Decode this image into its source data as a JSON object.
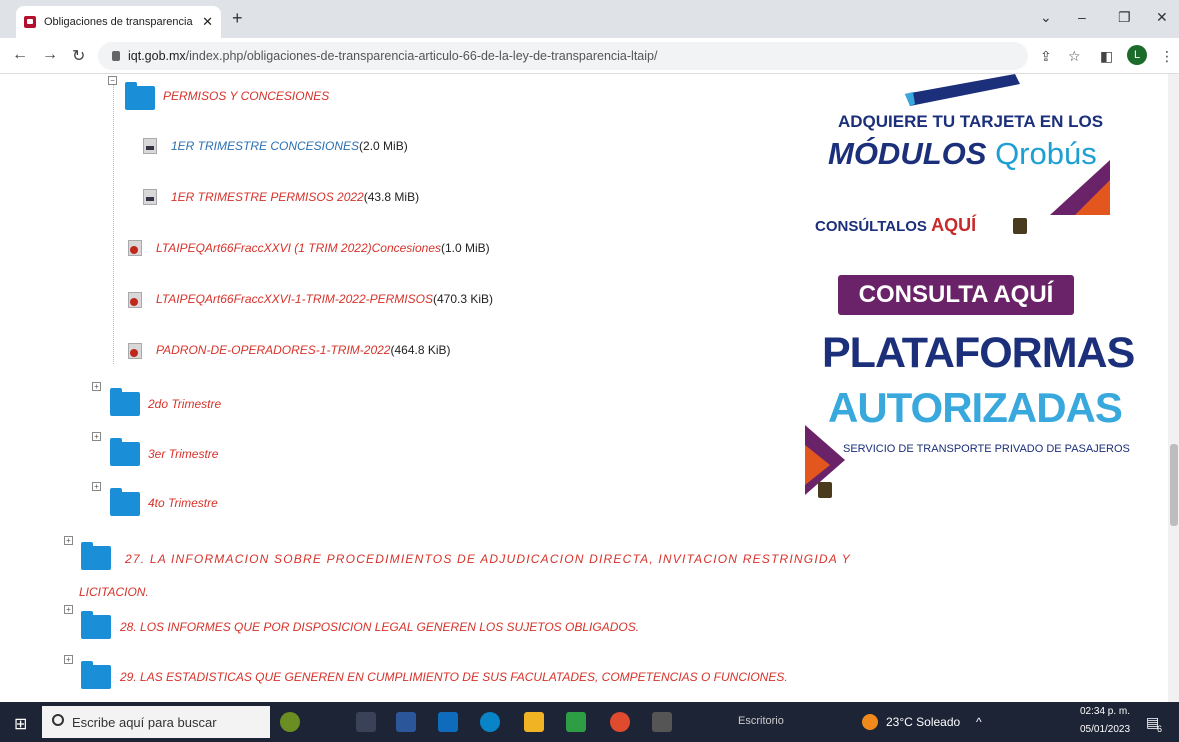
{
  "browser": {
    "tab_title": "Obligaciones de transparencia a",
    "tab_close": "✕",
    "new_tab": "+",
    "url_domain": "iqt.gob.mx",
    "url_path": "/index.php/obligaciones-de-transparencia-articulo-66-de-la-ley-de-transparencia-ltaip/",
    "avatar_letter": "L"
  },
  "tree": {
    "permisos": "PERMISOS Y CONCESIONES",
    "files": [
      {
        "name": "1ER TRIMESTRE CONCESIONES",
        "size": "(2.0 MiB)"
      },
      {
        "name": "1ER TRIMESTRE PERMISOS 2022",
        "size": "(43.8 MiB)"
      },
      {
        "name": "LTAIPEQArt66FraccXXVI (1 TRIM 2022)Concesiones",
        "size": "(1.0 MiB)"
      },
      {
        "name": "LTAIPEQArt66FraccXXVI-1-TRIM-2022-PERMISOS",
        "size": "(470.3 KiB)"
      },
      {
        "name": "PADRON-DE-OPERADORES-1-TRIM-2022",
        "size": "(464.8 KiB)"
      }
    ],
    "quarters": [
      "2do Trimestre",
      "3er Trimestre",
      "4to Trimestre"
    ],
    "item27a": "27. LA INFORMACION SOBRE PROCEDIMIENTOS DE ADJUDICACION DIRECTA, INVITACION RESTRINGIDA Y",
    "item27b": "LICITACION.",
    "item28": "28. LOS INFORMES QUE POR DISPOSICION LEGAL GENEREN LOS SUJETOS OBLIGADOS.",
    "item29": "29. LAS ESTADISTICAS QUE GENEREN EN CUMPLIMIENTO DE SUS FACULATADES, COMPETENCIAS O FUNCIONES."
  },
  "ad": {
    "line1": "ADQUIERE TU TARJETA EN LOS",
    "modulos": "MÓDULOS",
    "qrobus": "Qrobús",
    "consultalos": "CONSÚLTALOS",
    "aqui": "AQUÍ",
    "consulta_aqui": "CONSULTA AQUÍ",
    "plataformas": "PLATAFORMAS",
    "autorizadas": "AUTORIZADAS",
    "servicio": "SERVICIO DE TRANSPORTE PRIVADO DE PASAJEROS"
  },
  "taskbar": {
    "search_placeholder": "Escribe aquí para buscar",
    "escritorio": "Escritorio",
    "weather": "23°C Soleado",
    "time": "02:34 p. m.",
    "date": "05/01/2023",
    "notif_count": "6"
  }
}
